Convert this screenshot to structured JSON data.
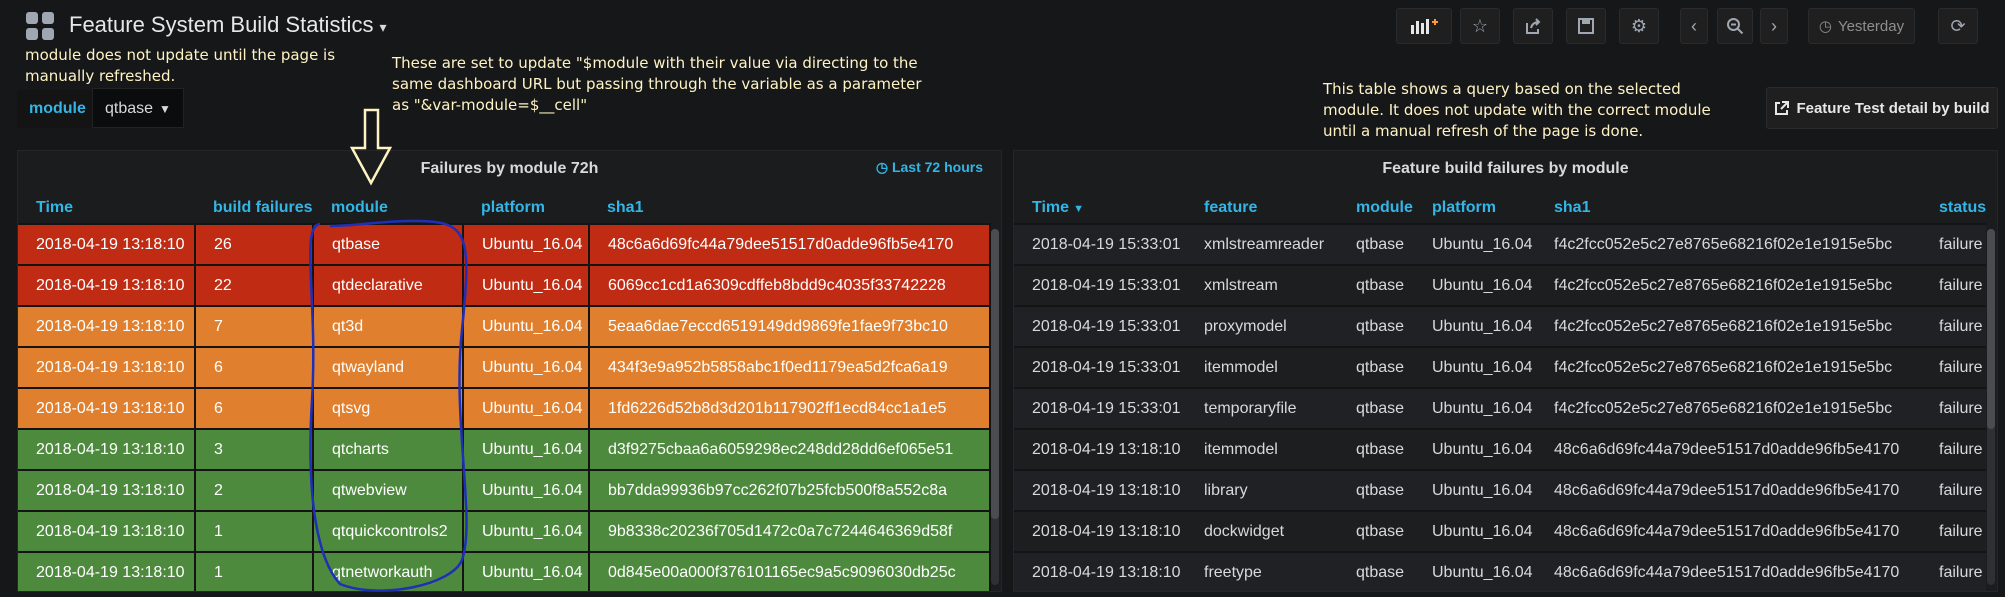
{
  "header": {
    "title": "Feature System Build Statistics",
    "time_label": "Yesterday"
  },
  "notes": {
    "left": "module does not update until the page is manually refreshed.",
    "middle": "These are set to update \"$module with their value via directing to the same dashboard URL but passing through the variable as a parameter as \"&var-module=$__cell\"",
    "right": "This table shows a query based on the selected module. It does not update with the correct module until a manual refresh of the page is done."
  },
  "variable": {
    "label": "module",
    "value": "qtbase"
  },
  "link_button": {
    "label": "Feature Test detail by build"
  },
  "left_panel": {
    "title": "Failures by module 72h",
    "time_info": "Last 72 hours",
    "columns": [
      "Time",
      "build failures",
      "module",
      "platform",
      "sha1"
    ],
    "rows": [
      {
        "time": "2018-04-19 13:18:10",
        "failures": "26",
        "module": "qtbase",
        "platform": "Ubuntu_16.04",
        "sha1": "48c6a6d69fc44a79dee51517d0adde96fb5e4170",
        "level": "red"
      },
      {
        "time": "2018-04-19 13:18:10",
        "failures": "22",
        "module": "qtdeclarative",
        "platform": "Ubuntu_16.04",
        "sha1": "6069cc1cd1a6309cdffeb8bdd9c4035f33742228",
        "level": "red"
      },
      {
        "time": "2018-04-19 13:18:10",
        "failures": "7",
        "module": "qt3d",
        "platform": "Ubuntu_16.04",
        "sha1": "5eaa6dae7eccd6519149dd9869fe1fae9f73bc10",
        "level": "orange"
      },
      {
        "time": "2018-04-19 13:18:10",
        "failures": "6",
        "module": "qtwayland",
        "platform": "Ubuntu_16.04",
        "sha1": "434f3e9a952b5858abc1f0ed1179ea5d2fca6a19",
        "level": "orange"
      },
      {
        "time": "2018-04-19 13:18:10",
        "failures": "6",
        "module": "qtsvg",
        "platform": "Ubuntu_16.04",
        "sha1": "1fd6226d52b8d3d201b117902ff1ecd84cc1a1e5",
        "level": "orange"
      },
      {
        "time": "2018-04-19 13:18:10",
        "failures": "3",
        "module": "qtcharts",
        "platform": "Ubuntu_16.04",
        "sha1": "d3f9275cbaa6a6059298ec248dd28dd6ef065e51",
        "level": "green"
      },
      {
        "time": "2018-04-19 13:18:10",
        "failures": "2",
        "module": "qtwebview",
        "platform": "Ubuntu_16.04",
        "sha1": "bb7dda99936b97cc262f07b25fcb500f8a552c8a",
        "level": "green"
      },
      {
        "time": "2018-04-19 13:18:10",
        "failures": "1",
        "module": "qtquickcontrols2",
        "platform": "Ubuntu_16.04",
        "sha1": "9b8338c20236f705d1472c0a7c7244646369d58f",
        "level": "green"
      },
      {
        "time": "2018-04-19 13:18:10",
        "failures": "1",
        "module": "qtnetworkauth",
        "platform": "Ubuntu_16.04",
        "sha1": "0d845e00a000f376101165ec9a5c9096030db25c",
        "level": "green"
      }
    ]
  },
  "right_panel": {
    "title": "Feature build failures by module",
    "columns": [
      "Time",
      "feature",
      "module",
      "platform",
      "sha1",
      "status"
    ],
    "rows": [
      {
        "time": "2018-04-19 15:33:01",
        "feature": "xmlstreamreader",
        "module": "qtbase",
        "platform": "Ubuntu_16.04",
        "sha1": "f4c2fcc052e5c27e8765e68216f02e1e1915e5bc",
        "status": "failure"
      },
      {
        "time": "2018-04-19 15:33:01",
        "feature": "xmlstream",
        "module": "qtbase",
        "platform": "Ubuntu_16.04",
        "sha1": "f4c2fcc052e5c27e8765e68216f02e1e1915e5bc",
        "status": "failure"
      },
      {
        "time": "2018-04-19 15:33:01",
        "feature": "proxymodel",
        "module": "qtbase",
        "platform": "Ubuntu_16.04",
        "sha1": "f4c2fcc052e5c27e8765e68216f02e1e1915e5bc",
        "status": "failure"
      },
      {
        "time": "2018-04-19 15:33:01",
        "feature": "itemmodel",
        "module": "qtbase",
        "platform": "Ubuntu_16.04",
        "sha1": "f4c2fcc052e5c27e8765e68216f02e1e1915e5bc",
        "status": "failure"
      },
      {
        "time": "2018-04-19 15:33:01",
        "feature": "temporaryfile",
        "module": "qtbase",
        "platform": "Ubuntu_16.04",
        "sha1": "f4c2fcc052e5c27e8765e68216f02e1e1915e5bc",
        "status": "failure"
      },
      {
        "time": "2018-04-19 13:18:10",
        "feature": "itemmodel",
        "module": "qtbase",
        "platform": "Ubuntu_16.04",
        "sha1": "48c6a6d69fc44a79dee51517d0adde96fb5e4170",
        "status": "failure"
      },
      {
        "time": "2018-04-19 13:18:10",
        "feature": "library",
        "module": "qtbase",
        "platform": "Ubuntu_16.04",
        "sha1": "48c6a6d69fc44a79dee51517d0adde96fb5e4170",
        "status": "failure"
      },
      {
        "time": "2018-04-19 13:18:10",
        "feature": "dockwidget",
        "module": "qtbase",
        "platform": "Ubuntu_16.04",
        "sha1": "48c6a6d69fc44a79dee51517d0adde96fb5e4170",
        "status": "failure"
      },
      {
        "time": "2018-04-19 13:18:10",
        "feature": "freetype",
        "module": "qtbase",
        "platform": "Ubuntu_16.04",
        "sha1": "48c6a6d69fc44a79dee51517d0adde96fb5e4170",
        "status": "failure"
      }
    ]
  },
  "colors": {
    "red": "#c02b14",
    "orange": "#e0802e",
    "green": "#4e8a3e",
    "accent": "#33b5e5",
    "annotation_arrow": "#fff3c4",
    "annotation_circle": "#1f2fb8"
  },
  "icons": [
    "app-grid-icon",
    "add-panel-icon",
    "star-icon",
    "share-icon",
    "save-icon",
    "gear-icon",
    "chevron-left-icon",
    "zoom-out-icon",
    "chevron-right-icon",
    "clock-icon",
    "refresh-icon",
    "external-link-icon"
  ]
}
